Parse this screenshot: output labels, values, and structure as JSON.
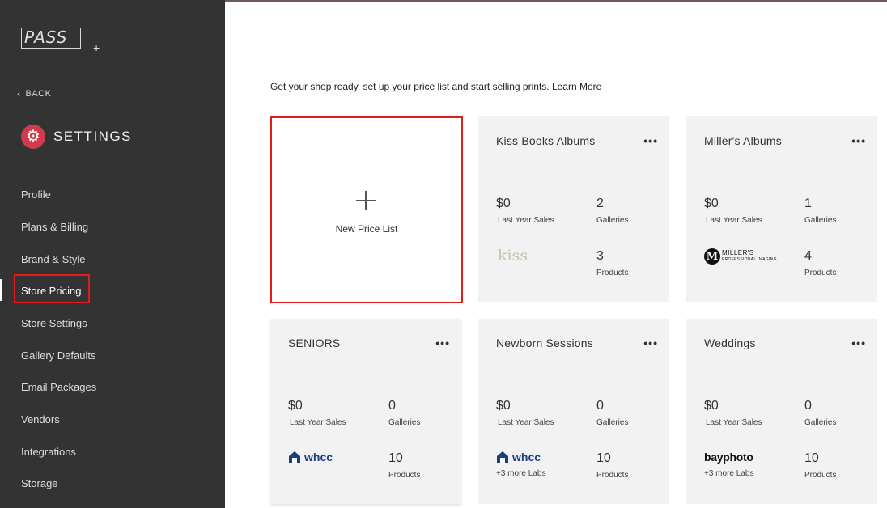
{
  "sidebar": {
    "logo_text": "PASS",
    "logo_plus": "+",
    "back_label": "BACK",
    "title": "SETTINGS",
    "items": [
      {
        "label": "Profile"
      },
      {
        "label": "Plans & Billing"
      },
      {
        "label": "Brand & Style"
      },
      {
        "label": "Store Pricing"
      },
      {
        "label": "Store Settings"
      },
      {
        "label": "Gallery Defaults"
      },
      {
        "label": "Email Packages"
      },
      {
        "label": "Vendors"
      },
      {
        "label": "Integrations"
      },
      {
        "label": "Storage"
      }
    ],
    "active_item": "Store Pricing"
  },
  "main": {
    "intro_text": "Get your shop ready, set up your price list and start selling prints.",
    "learn_more": "Learn More",
    "new_card_label": "New Price List",
    "sales_label": "Last Year Sales",
    "galleries_label": "Galleries",
    "products_label": "Products",
    "cards": [
      {
        "name": "Kiss Books Albums",
        "sales": "$0",
        "galleries": "2",
        "products": "3",
        "lab_logo": "kiss",
        "more_labs": ""
      },
      {
        "name": "Miller's Albums",
        "sales": "$0",
        "galleries": "1",
        "products": "4",
        "lab_logo": "MILLER'S",
        "lab_logo_sub": "PROFESSIONAL IMAGING",
        "more_labs": ""
      },
      {
        "name": "SENIORS",
        "sales": "$0",
        "galleries": "0",
        "products": "10",
        "lab_logo": "whcc",
        "more_labs": ""
      },
      {
        "name": "Newborn Sessions",
        "sales": "$0",
        "galleries": "0",
        "products": "10",
        "lab_logo": "whcc",
        "more_labs": "+3 more Labs"
      },
      {
        "name": "Weddings",
        "sales": "$0",
        "galleries": "0",
        "products": "10",
        "lab_logo": "bayphoto",
        "more_labs": "+3 more Labs"
      }
    ]
  },
  "colors": {
    "sidebar_bg": "#333333",
    "accent_red": "#d23a4e",
    "highlight_outline": "#e21b1b",
    "card_bg": "#f2f2f2",
    "whcc_blue": "#1a3f7a"
  },
  "icons": [
    "chevron-left-icon",
    "gear-icon",
    "plus-icon",
    "more-dots-icon",
    "whcc-house-icon"
  ]
}
